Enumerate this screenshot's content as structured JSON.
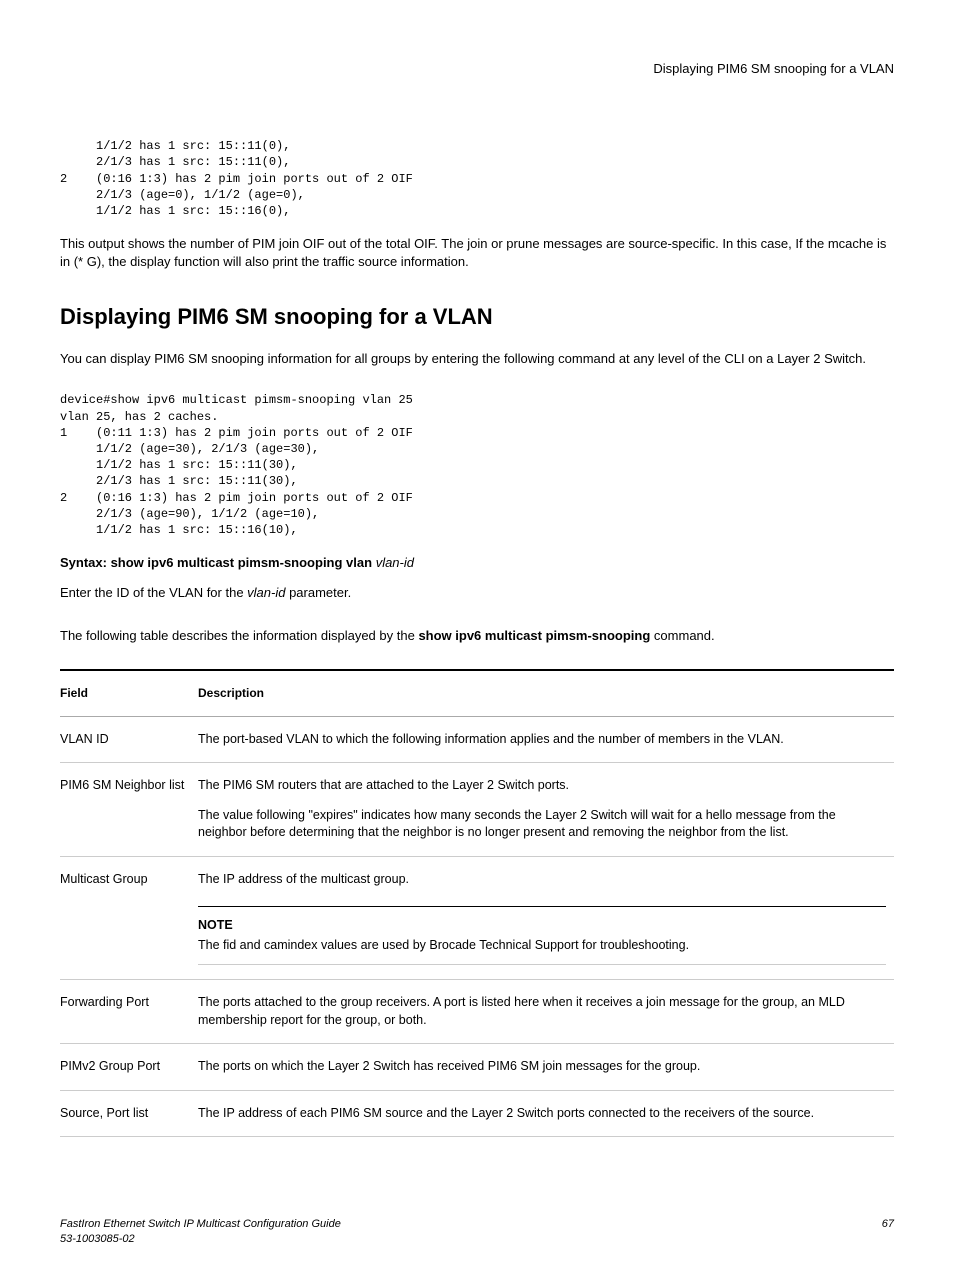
{
  "header": {
    "title": "Displaying PIM6 SM snooping for a VLAN"
  },
  "codeblock1": "     1/1/2 has 1 src: 15::11(0),\n     2/1/3 has 1 src: 15::11(0),\n2    (0:16 1:3) has 2 pim join ports out of 2 OIF\n     2/1/3 (age=0), 1/1/2 (age=0),\n     1/1/2 has 1 src: 15::16(0),",
  "para1": "This output shows the number of PIM join OIF out of the total OIF. The join or prune messages are source-specific. In this case, If the mcache is in (* G), the display function will also print the traffic source information.",
  "heading": "Displaying PIM6 SM snooping for a VLAN",
  "para2": "You can display PIM6 SM snooping information for all groups by entering the following command at any level of the CLI on a Layer 2 Switch.",
  "codeblock2": "device#show ipv6 multicast pimsm-snooping vlan 25\nvlan 25, has 2 caches.\n1    (0:11 1:3) has 2 pim join ports out of 2 OIF\n     1/1/2 (age=30), 2/1/3 (age=30),\n     1/1/2 has 1 src: 15::11(30),\n     2/1/3 has 1 src: 15::11(30),\n2    (0:16 1:3) has 2 pim join ports out of 2 OIF\n     2/1/3 (age=90), 1/1/2 (age=10),\n     1/1/2 has 1 src: 15::16(10),",
  "syntax": {
    "prefix": "Syntax: show ipv6 multicast pimsm-snooping vlan",
    "arg": "vlan-id"
  },
  "para3_a": "Enter the ID of the VLAN for the ",
  "para3_b": "vlan-id",
  "para3_c": " parameter.",
  "para4_a": "The following table describes the information displayed by the ",
  "para4_b": "show ipv6 multicast pimsm-snooping",
  "para4_c": " command.",
  "table": {
    "headers": {
      "col1": "Field",
      "col2": "Description"
    },
    "rows": [
      {
        "field": "VLAN ID",
        "desc": "The port-based VLAN to which the following information applies and the number of members in the VLAN."
      },
      {
        "field": "PIM6 SM Neighbor list",
        "desc_p1": "The PIM6 SM routers that are attached to the Layer 2 Switch ports.",
        "desc_p2": "The value following \"expires\" indicates how many seconds the Layer 2 Switch will wait for a hello message from the neighbor before determining that the neighbor is no longer present and removing the neighbor from the list."
      },
      {
        "field": "Multicast Group",
        "desc": "The IP address of the multicast group.",
        "note_label": "NOTE",
        "note_text": "The fid and camindex values are used by Brocade Technical Support for troubleshooting."
      },
      {
        "field": "Forwarding Port",
        "desc": "The ports attached to the group receivers. A port is listed here when it receives a join message for the group, an MLD membership report for the group, or both."
      },
      {
        "field": "PIMv2 Group Port",
        "desc": "The ports on which the Layer 2 Switch has received PIM6 SM join messages for the group."
      },
      {
        "field": "Source, Port list",
        "desc": "The IP address of each PIM6 SM source and the Layer 2 Switch ports connected to the receivers of the source."
      }
    ]
  },
  "footer": {
    "line1": "FastIron Ethernet Switch IP Multicast Configuration Guide",
    "line2": "53-1003085-02",
    "page": "67"
  }
}
